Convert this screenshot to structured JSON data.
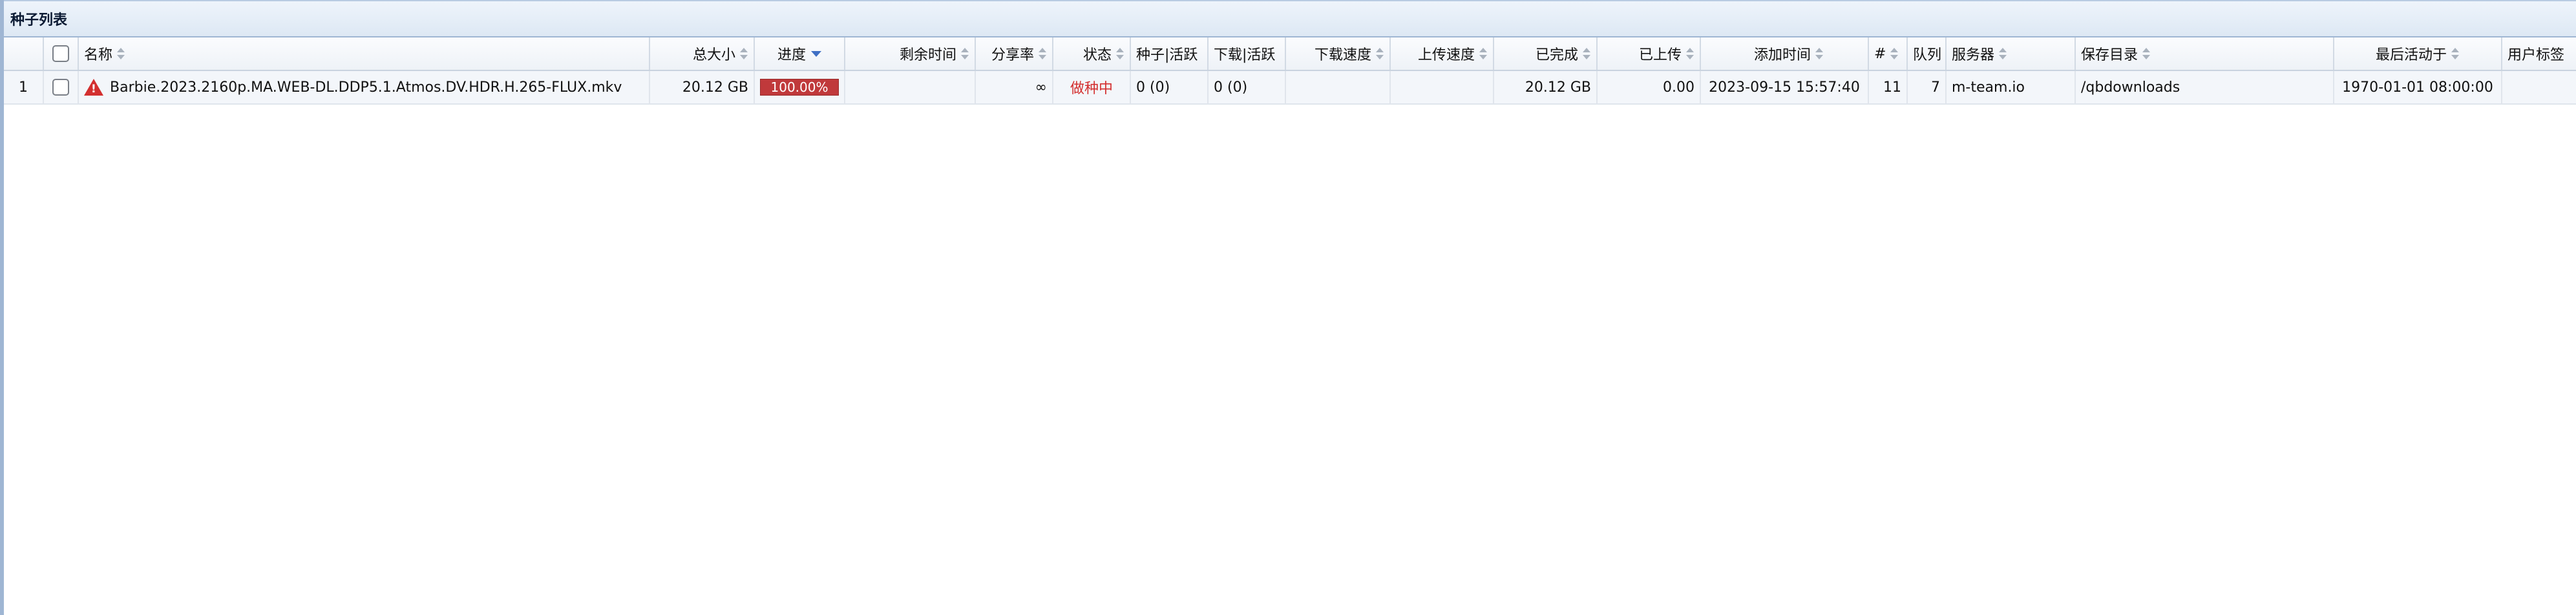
{
  "panel": {
    "title": "种子列表"
  },
  "columns": {
    "row_num": "",
    "name": "名称",
    "size": "总大小",
    "progress": "进度",
    "eta": "剩余时间",
    "ratio": "分享率",
    "state": "状态",
    "seeds": "种子|活跃",
    "peers": "下载|活跃",
    "dlspeed": "下载速度",
    "upspeed": "上传速度",
    "completed": "已完成",
    "uploaded": "已上传",
    "added_on": "添加时间",
    "hash_num": "#",
    "queue": "队列",
    "tracker": "服务器",
    "save_path": "保存目录",
    "last_activity": "最后活动于",
    "tags": "用户标签"
  },
  "rows": [
    {
      "row_num": "1",
      "name": "Barbie.2023.2160p.MA.WEB-DL.DDP5.1.Atmos.DV.HDR.H.265-FLUX.mkv",
      "size": "20.12 GB",
      "progress_text": "100.00%",
      "progress_fraction": 1.0,
      "eta": "",
      "ratio": "∞",
      "state": "做种中",
      "seeds": "0 (0)",
      "peers": "0 (0)",
      "dlspeed": "",
      "upspeed": "",
      "completed": "20.12 GB",
      "uploaded": "0.00",
      "added_on": "2023-09-15 15:57:40",
      "hash_num": "11",
      "queue": "7",
      "tracker": "m-team.io",
      "save_path": "/qbdownloads",
      "last_activity": "1970-01-01 08:00:00",
      "tags": ""
    }
  ],
  "colors": {
    "progress_fill": "#c0393b",
    "status_seeding": "#d32f2f",
    "warning_icon": "#d32f2f"
  },
  "icons": {
    "row_status": "warning-triangle-icon",
    "sort": "sort-arrows-icon",
    "sort_active": "sort-desc-icon"
  }
}
